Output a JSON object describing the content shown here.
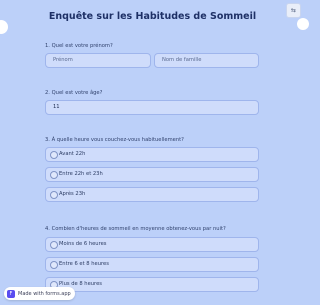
{
  "lang_button": "⇆",
  "title": "Enquête sur les Habitudes de Sommeil",
  "q1": {
    "label": "1. Quel est votre prénom?",
    "first_name_placeholder": "Prénom",
    "last_name_placeholder": "Nom de famille"
  },
  "q2": {
    "label": "2. Quel est votre âge?",
    "value": "11"
  },
  "q3": {
    "label": "3. À quelle heure vous couchez-vous habituellement?",
    "options": [
      "Avant 22h",
      "Entre 22h et 23h",
      "Après 23h"
    ]
  },
  "q4": {
    "label": "4. Combien d'heures de sommeil en moyenne obtenez-vous par nuit?",
    "options": [
      "Moins de 6 heures",
      "Entre 6 et 8 heures",
      "Plus de 8 heures"
    ]
  },
  "badge": {
    "logo": "F",
    "text": "Made with forms.app"
  },
  "colors": {
    "background": "#bcd0f9",
    "field_background": "#cfdcfb",
    "field_border": "#9fb5ec",
    "title": "#1e3066"
  }
}
